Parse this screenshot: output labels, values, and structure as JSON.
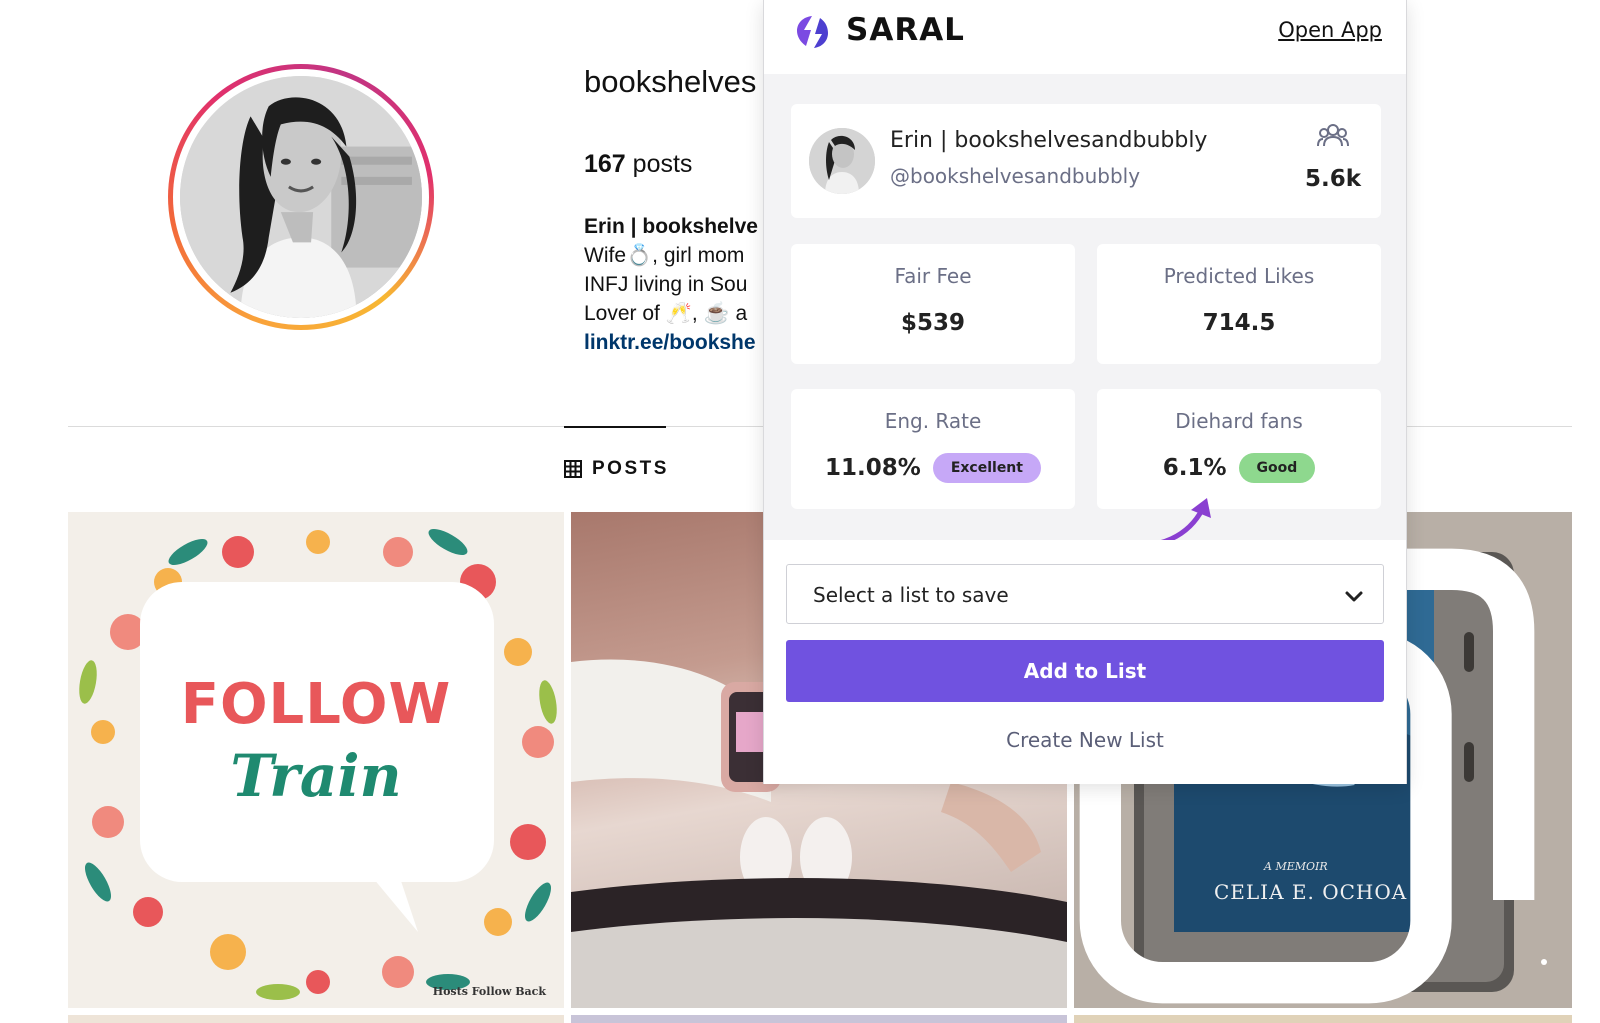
{
  "profile": {
    "username": "bookshelves",
    "posts_count": "167",
    "posts_word": "posts",
    "bio_name": "Erin | bookshelve",
    "bio_line1": "Wife💍, girl mom",
    "bio_line2": "INFJ living in Sou",
    "bio_line3": "Lover of 🥂, ☕ a",
    "bio_link": "linktr.ee/bookshe"
  },
  "tabs": {
    "posts_label": "POSTS"
  },
  "posts": {
    "follow_word": "FOLLOW",
    "train_word": "Train",
    "hosts_text": "Hosts Follow Back",
    "memoir_text": "A MEMOIR",
    "author_text": "CELIA E. OCHOA"
  },
  "saral": {
    "brand": "SARAL",
    "open_app": "Open App",
    "creator_name": "Erin | bookshelvesandbubbly",
    "creator_handle": "@bookshelvesandbubbly",
    "followers": "5.6k",
    "stats": {
      "fair_fee_label": "Fair Fee",
      "fair_fee_value": "$539",
      "predicted_likes_label": "Predicted Likes",
      "predicted_likes_value": "714.5",
      "eng_rate_label": "Eng. Rate",
      "eng_rate_value": "11.08%",
      "eng_rate_badge": "Excellent",
      "diehard_label": "Diehard fans",
      "diehard_value": "6.1%",
      "diehard_badge": "Good"
    },
    "select_placeholder": "Select a list to save",
    "add_button": "Add to List",
    "create_new": "Create New List",
    "colors": {
      "accent": "#7052e0",
      "excellent": "#c6a8f7",
      "good": "#8ed88e",
      "arrow": "#8a3fd1"
    }
  },
  "icons": [
    "grid-icon",
    "multi-post-icon",
    "saral-logo-icon",
    "followers-icon",
    "chevron-down-icon",
    "arrow-annotation-icon"
  ]
}
